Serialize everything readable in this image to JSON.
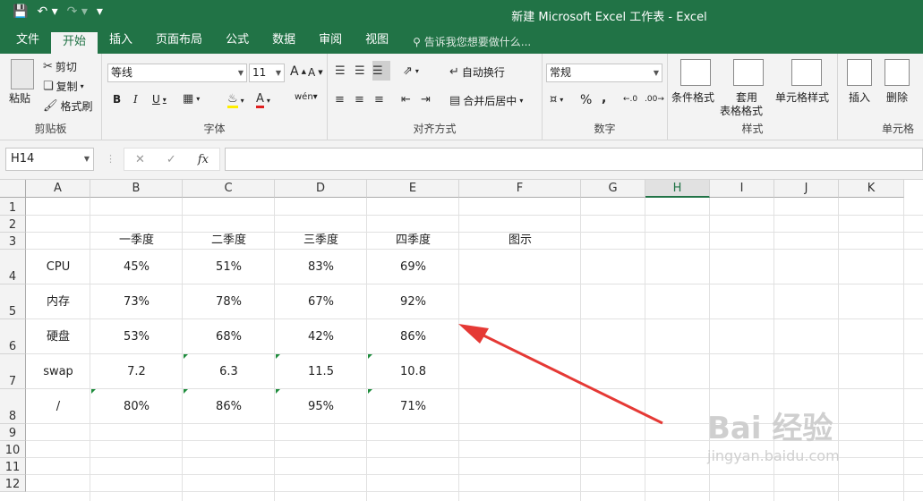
{
  "app": {
    "title": "新建 Microsoft Excel 工作表 - Excel"
  },
  "tabs": [
    "文件",
    "开始",
    "插入",
    "页面布局",
    "公式",
    "数据",
    "审阅",
    "视图"
  ],
  "tell_me": "告诉我您想要做什么...",
  "ribbon": {
    "clipboard": {
      "paste": "粘贴",
      "cut": "剪切",
      "copy": "复制",
      "format_painter": "格式刷",
      "label": "剪贴板"
    },
    "font": {
      "name": "等线",
      "size": "11",
      "bold": "B",
      "italic": "I",
      "underline": "U",
      "label": "字体",
      "grow": "A",
      "shrink": "A"
    },
    "alignment": {
      "wrap": "自动换行",
      "merge": "合并后居中",
      "label": "对齐方式"
    },
    "number": {
      "format": "常规",
      "percent": "%",
      "comma": ",",
      "label": "数字"
    },
    "styles": {
      "conditional": "条件格式",
      "table_line1": "套用",
      "table_line2": "表格格式",
      "cell_styles": "单元格样式",
      "label": "样式"
    },
    "cells": {
      "insert": "插入",
      "delete": "删除",
      "label": "单元格"
    }
  },
  "formula_bar": {
    "name_box": "H14",
    "fx": "fx",
    "value": ""
  },
  "sheet": {
    "columns": [
      "A",
      "B",
      "C",
      "D",
      "E",
      "F",
      "G",
      "H",
      "I",
      "J",
      "K"
    ],
    "rows": [
      "1",
      "2",
      "3",
      "4",
      "5",
      "6",
      "7",
      "8",
      "9",
      "10",
      "11",
      "12"
    ],
    "selected_column": "H",
    "row3": {
      "b": "一季度",
      "c": "二季度",
      "d": "三季度",
      "e": "四季度",
      "f": "图示"
    },
    "data": [
      {
        "label": "CPU",
        "values": [
          "45%",
          "51%",
          "83%",
          "69%"
        ]
      },
      {
        "label": "内存",
        "values": [
          "73%",
          "78%",
          "67%",
          "92%"
        ]
      },
      {
        "label": "硬盘",
        "values": [
          "53%",
          "68%",
          "42%",
          "86%"
        ]
      },
      {
        "label": "swap",
        "values": [
          "7.2",
          "6.3",
          "11.5",
          "10.8"
        ]
      },
      {
        "label": "/",
        "values": [
          "80%",
          "86%",
          "95%",
          "71%"
        ]
      }
    ]
  },
  "colors": {
    "excel_green": "#217346",
    "arrow": "#e53935"
  },
  "watermark": {
    "brand": "Bai 经验",
    "url": "jingyan.baidu.com"
  }
}
